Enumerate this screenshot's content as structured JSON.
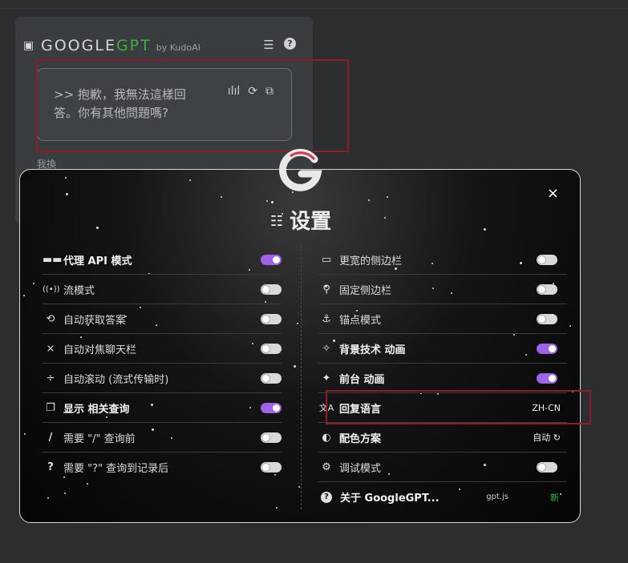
{
  "background": {
    "logo_main": "GOOGLE",
    "logo_accent": "GPT",
    "byline": "by KudoAI",
    "answer_text": ">> 抱歉，我無法這樣回答。你有其他問題嗎?",
    "under_row_text": "我換"
  },
  "modal": {
    "title": "设置",
    "close_label": "×",
    "left_items": [
      {
        "label": "代理 API 模式",
        "icon": "glasses-icon",
        "glyph": "👓",
        "state": true
      },
      {
        "label": "流模式",
        "icon": "broadcast-icon",
        "glyph": "((•))",
        "state": false
      },
      {
        "label": "自动获取答案",
        "icon": "refresh-icon",
        "glyph": "⟲",
        "state": false
      },
      {
        "label": "自动对焦聊天栏",
        "icon": "focus-icon",
        "glyph": "⨯",
        "state": false
      },
      {
        "label": "自动滚动 (流式传输时)",
        "icon": "scroll-icon",
        "glyph": "÷",
        "state": false
      },
      {
        "label": "显示 相关查询",
        "icon": "window-icon",
        "glyph": "❐",
        "state": true
      },
      {
        "label": "需要 \"/\" 查询前",
        "icon": "slash-icon",
        "glyph": "/",
        "state": false
      },
      {
        "label": "需要 \"?\" 查询到记录后",
        "icon": "question-icon",
        "glyph": "?",
        "state": false
      }
    ],
    "right_items": [
      {
        "label": "更宽的侧边栏",
        "icon": "widescreen-icon",
        "glyph": "▭",
        "state": false
      },
      {
        "label": "固定侧边栏",
        "icon": "pin-icon",
        "glyph": "⚲",
        "state": false
      },
      {
        "label": "锚点模式",
        "icon": "anchor-icon",
        "glyph": "⚓",
        "state": false
      },
      {
        "label": "背景技术 动画",
        "icon": "sparkles-icon",
        "glyph": "✧",
        "state": true
      },
      {
        "label": "前台 动画",
        "icon": "sparkles-filled-icon",
        "glyph": "✦",
        "state": true
      },
      {
        "label": "回复语言",
        "icon": "translate-icon",
        "glyph": "文A",
        "value": "ZH-CN"
      },
      {
        "label": "配色方案",
        "icon": "contrast-icon",
        "glyph": "◐",
        "value": "自动 ↻"
      },
      {
        "label": "调试模式",
        "icon": "bug-icon",
        "glyph": "⚙",
        "state": false
      },
      {
        "label": "关于 GoogleGPT...",
        "icon": "info-icon",
        "glyph": "?",
        "ext": "gpt.js",
        "badge": "新"
      }
    ]
  }
}
